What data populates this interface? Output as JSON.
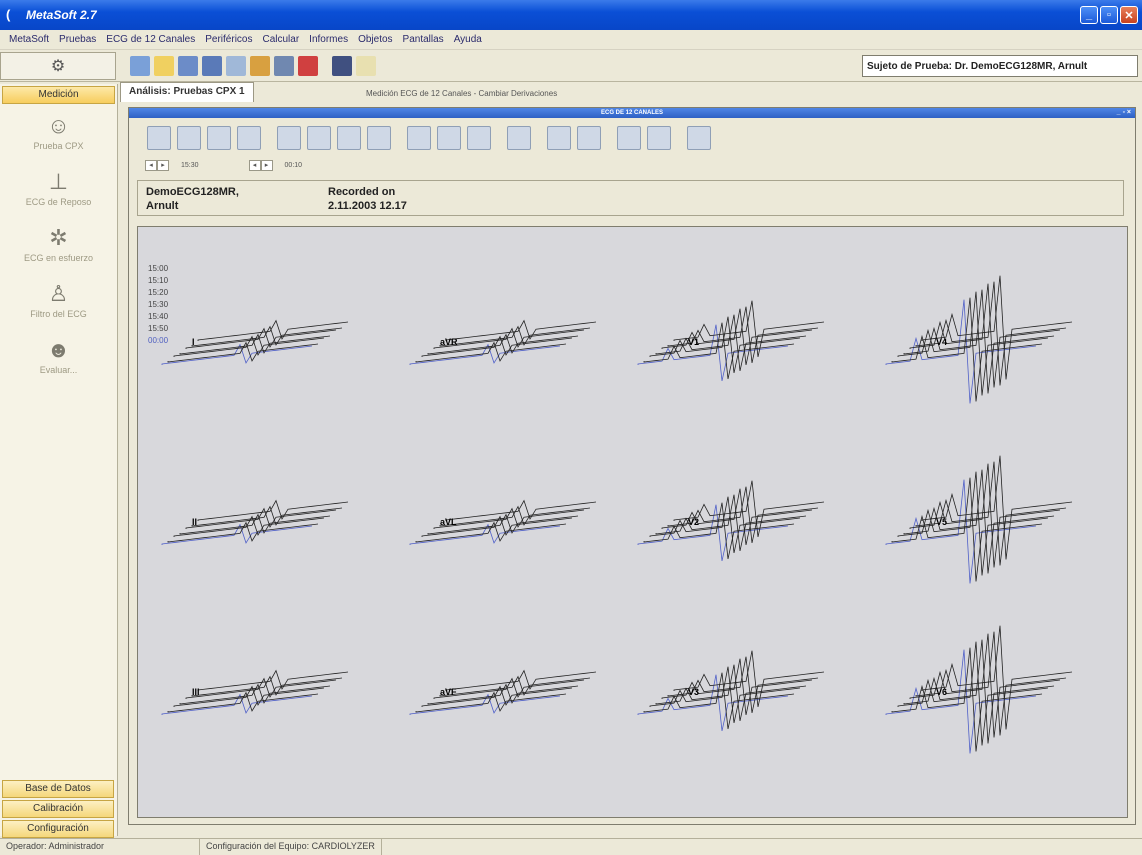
{
  "window": {
    "title": "MetaSoft 2.7"
  },
  "menu": [
    "MetaSoft",
    "Pruebas",
    "ECG de 12 Canales",
    "Periféricos",
    "Calcular",
    "Informes",
    "Objetos",
    "Pantallas",
    "Ayuda"
  ],
  "subject": "Sujeto de Prueba: Dr. DemoECG128MR, Arnult",
  "sidebar": {
    "header": "Medición",
    "items": [
      "Prueba CPX",
      "ECG de Reposo",
      "ECG en esfuerzo",
      "Filtro del ECG",
      "Evaluar..."
    ],
    "bottom": [
      "Base de Datos",
      "Calibración",
      "Configuración"
    ]
  },
  "tabs": {
    "active": "Análisis: Pruebas CPX 1",
    "secondary": "Medición ECG de 12 Canales - Cambiar Derivaciones"
  },
  "mdi": {
    "title": "ECG DE 12 CANALES",
    "ctl": "_ ▫ ×"
  },
  "nav": {
    "time1": "15:30",
    "time2": "00:10"
  },
  "info": {
    "name_line1": "DemoECG128MR,",
    "name_line2": "Arnult",
    "rec_line1": "Recorded on",
    "rec_line2": "2.11.2003   12.17"
  },
  "times": [
    "15:00",
    "15:10",
    "15:20",
    "15:30",
    "15:40",
    "15:50",
    "00:00"
  ],
  "leads": [
    "I",
    "aVR",
    "V1",
    "V4",
    "II",
    "aVL",
    "V2",
    "V5",
    "III",
    "aVF",
    "V3",
    "V6"
  ],
  "status": {
    "operator": "Operador: Administrador",
    "config": "Configuración del Equipo: CARDIOLYZER"
  }
}
